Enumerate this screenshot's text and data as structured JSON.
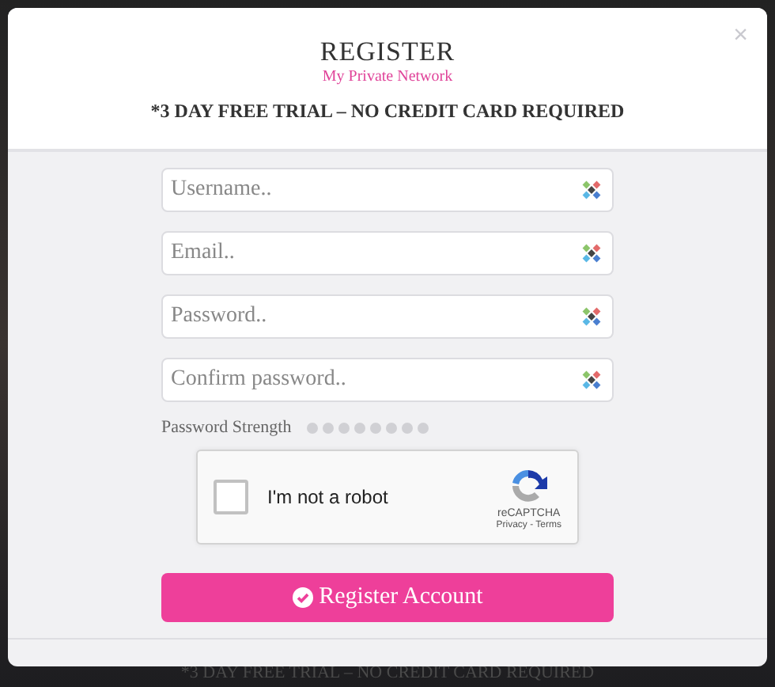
{
  "modal": {
    "title": "REGISTER",
    "subtitle": "My Private Network",
    "notice": "*3 DAY FREE TRIAL – NO CREDIT CARD REQUIRED",
    "close": "×"
  },
  "fields": [
    {
      "placeholder": "Username.."
    },
    {
      "placeholder": "Email.."
    },
    {
      "placeholder": "Password.."
    },
    {
      "placeholder": "Confirm password.."
    }
  ],
  "password_strength": {
    "label": "Password Strength"
  },
  "captcha": {
    "label": "I'm not a robot",
    "checked": false,
    "brand": "reCAPTCHA",
    "links": "Privacy - Terms"
  },
  "submit_button": "Register Account",
  "backdrop_text": "*3 DAY FREE TRIAL – NO CREDIT CARD REQUIRED"
}
